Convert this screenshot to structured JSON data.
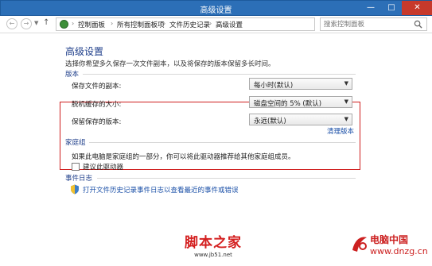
{
  "window": {
    "title": "高级设置",
    "min_label": "—",
    "max_label": "□",
    "close_label": "✕"
  },
  "nav": {
    "back_glyph": "←",
    "forward_glyph": "→",
    "up_glyph": "↑",
    "breadcrumbs": [
      "控制面板",
      "所有控制面板项",
      "文件历史记录",
      "高级设置"
    ],
    "separator": "›",
    "search_placeholder": "搜索控制面板"
  },
  "page": {
    "title": "高级设置",
    "description": "选择你希望多久保存一次文件副本，以及将保存的版本保留多长时间。"
  },
  "versions": {
    "heading": "版本",
    "rows": [
      {
        "label": "保存文件的副本:",
        "value": "每小时(默认)"
      },
      {
        "label": "脱机缓存的大小:",
        "value": "磁盘空间的 5% (默认)"
      },
      {
        "label": "保留保存的版本:",
        "value": "永远(默认)"
      }
    ],
    "cleanup_link": "清理版本"
  },
  "homegroup": {
    "heading": "家庭组",
    "description": "如果此电脑是家庭组的一部分，你可以将此驱动器推荐给其他家庭组成员。",
    "checkbox_label": "建议此驱动器",
    "checked": false
  },
  "eventlog": {
    "heading": "事件日志",
    "link": "打开文件历史记录事件日志以查看最近的事件或错误"
  },
  "watermarks": {
    "left_title": "脚本之家",
    "left_url": "www.jb51.net",
    "right_name": "电脑中国",
    "right_url": "www.dnzg.cn"
  },
  "colors": {
    "titlebar": "#2c6fb7",
    "highlight_box": "#cf1d1d",
    "link": "#1a4fa7",
    "heading": "#1e3e8a"
  }
}
